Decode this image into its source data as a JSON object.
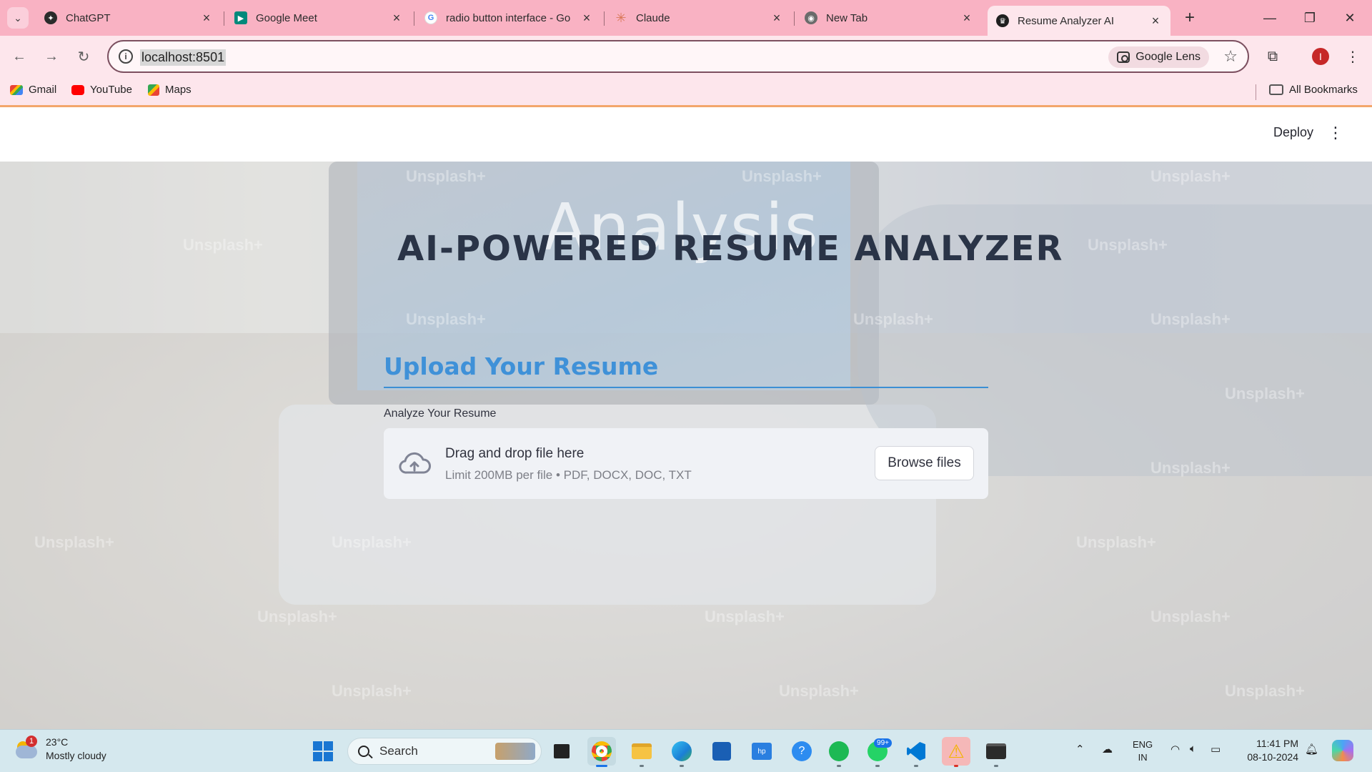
{
  "browser": {
    "tabs": [
      {
        "title": "ChatGPT",
        "icon": "chatgpt-icon"
      },
      {
        "title": "Google Meet",
        "icon": "google-meet-icon"
      },
      {
        "title": "radio button interface - Go",
        "icon": "google-icon"
      },
      {
        "title": "Claude",
        "icon": "claude-icon"
      },
      {
        "title": "New Tab",
        "icon": "chrome-icon"
      },
      {
        "title": "Resume Analyzer AI",
        "icon": "streamlit-icon"
      }
    ],
    "url": "localhost:8501",
    "lens_label": "Google Lens",
    "profile_initial": "I",
    "bookmarks": [
      {
        "label": "Gmail",
        "icon": "gmail-icon"
      },
      {
        "label": "YouTube",
        "icon": "youtube-icon"
      },
      {
        "label": "Maps",
        "icon": "maps-icon"
      }
    ],
    "all_bookmarks": "All Bookmarks"
  },
  "app": {
    "deploy_label": "Deploy",
    "menu_glyph": "⋮",
    "background_word": "Analysis",
    "watermark": "Unsplash+",
    "title": "AI-POWERED RESUME ANALYZER",
    "upload_header": "Upload Your Resume",
    "uploader_label": "Analyze Your Resume",
    "dropzone_title": "Drag and drop file here",
    "dropzone_limit": "Limit 200MB per file • PDF, DOCX, DOC, TXT",
    "browse_label": "Browse files"
  },
  "taskbar": {
    "weather_temp": "23°C",
    "weather_desc": "Mostly cloudy",
    "weather_badge": "1",
    "search_placeholder": "Search",
    "whatsapp_badge": "99+",
    "lang_line1": "ENG",
    "lang_line2": "IN",
    "time": "11:41 PM",
    "date": "08-10-2024"
  },
  "colors": {
    "tabbar": "#f9b2c3",
    "toolbar": "#fde6ec",
    "title": "#2a3447",
    "accent_blue": "#3f91d8"
  }
}
